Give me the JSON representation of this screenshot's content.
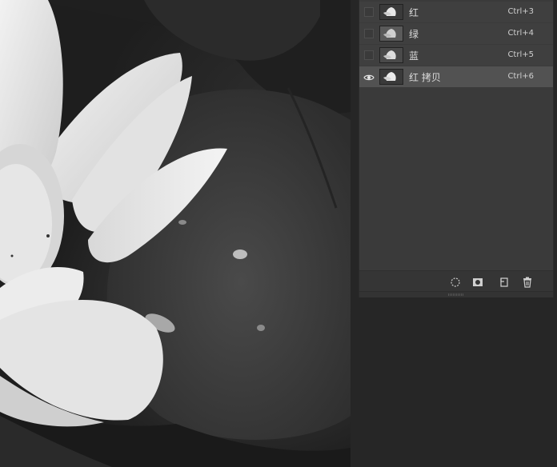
{
  "channels": {
    "items": [
      {
        "name": "红",
        "shortcut": "Ctrl+3",
        "visible": false,
        "selected": false
      },
      {
        "name": "绿",
        "shortcut": "Ctrl+4",
        "visible": false,
        "selected": false
      },
      {
        "name": "蓝",
        "shortcut": "Ctrl+5",
        "visible": false,
        "selected": false
      },
      {
        "name": "红 拷贝",
        "shortcut": "Ctrl+6",
        "visible": true,
        "selected": true
      }
    ]
  },
  "footer": {
    "tools": [
      "load-selection-icon",
      "save-selection-icon",
      "new-channel-icon",
      "trash-icon"
    ]
  },
  "colors": {
    "panel_bg": "#3a3a3a",
    "row_bg": "#3f3f3f",
    "row_selected_bg": "#525252",
    "workspace_bg": "#262626",
    "text": "#dcdcdc"
  }
}
